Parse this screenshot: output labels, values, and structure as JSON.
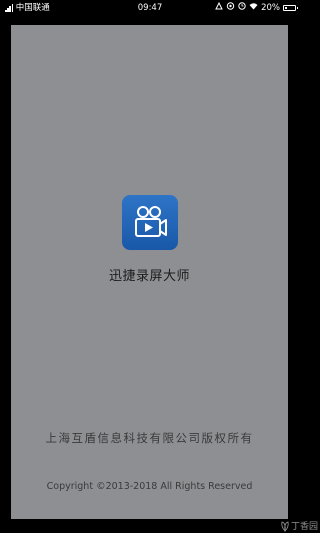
{
  "status_bar": {
    "carrier": "中国联通",
    "time": "09:47",
    "battery_percent": "20%",
    "battery_level": 0.2,
    "icons": [
      "signal-icon",
      "alarm-icon",
      "eye-icon",
      "clock-icon",
      "wifi-icon",
      "battery-icon"
    ]
  },
  "splash": {
    "app_name": "迅捷录屏大师",
    "app_icon": "video-camera-icon",
    "company": "上海互盾信息科技有限公司版权所有",
    "copyright": "Copyright ©2013-2018 All Rights Reserved"
  },
  "watermark": {
    "icon": "leaf-logo-icon",
    "text": "丁香园"
  },
  "colors": {
    "overlay": "#8d8f93",
    "icon_blue": "#1f63b4",
    "background": "#000000"
  }
}
